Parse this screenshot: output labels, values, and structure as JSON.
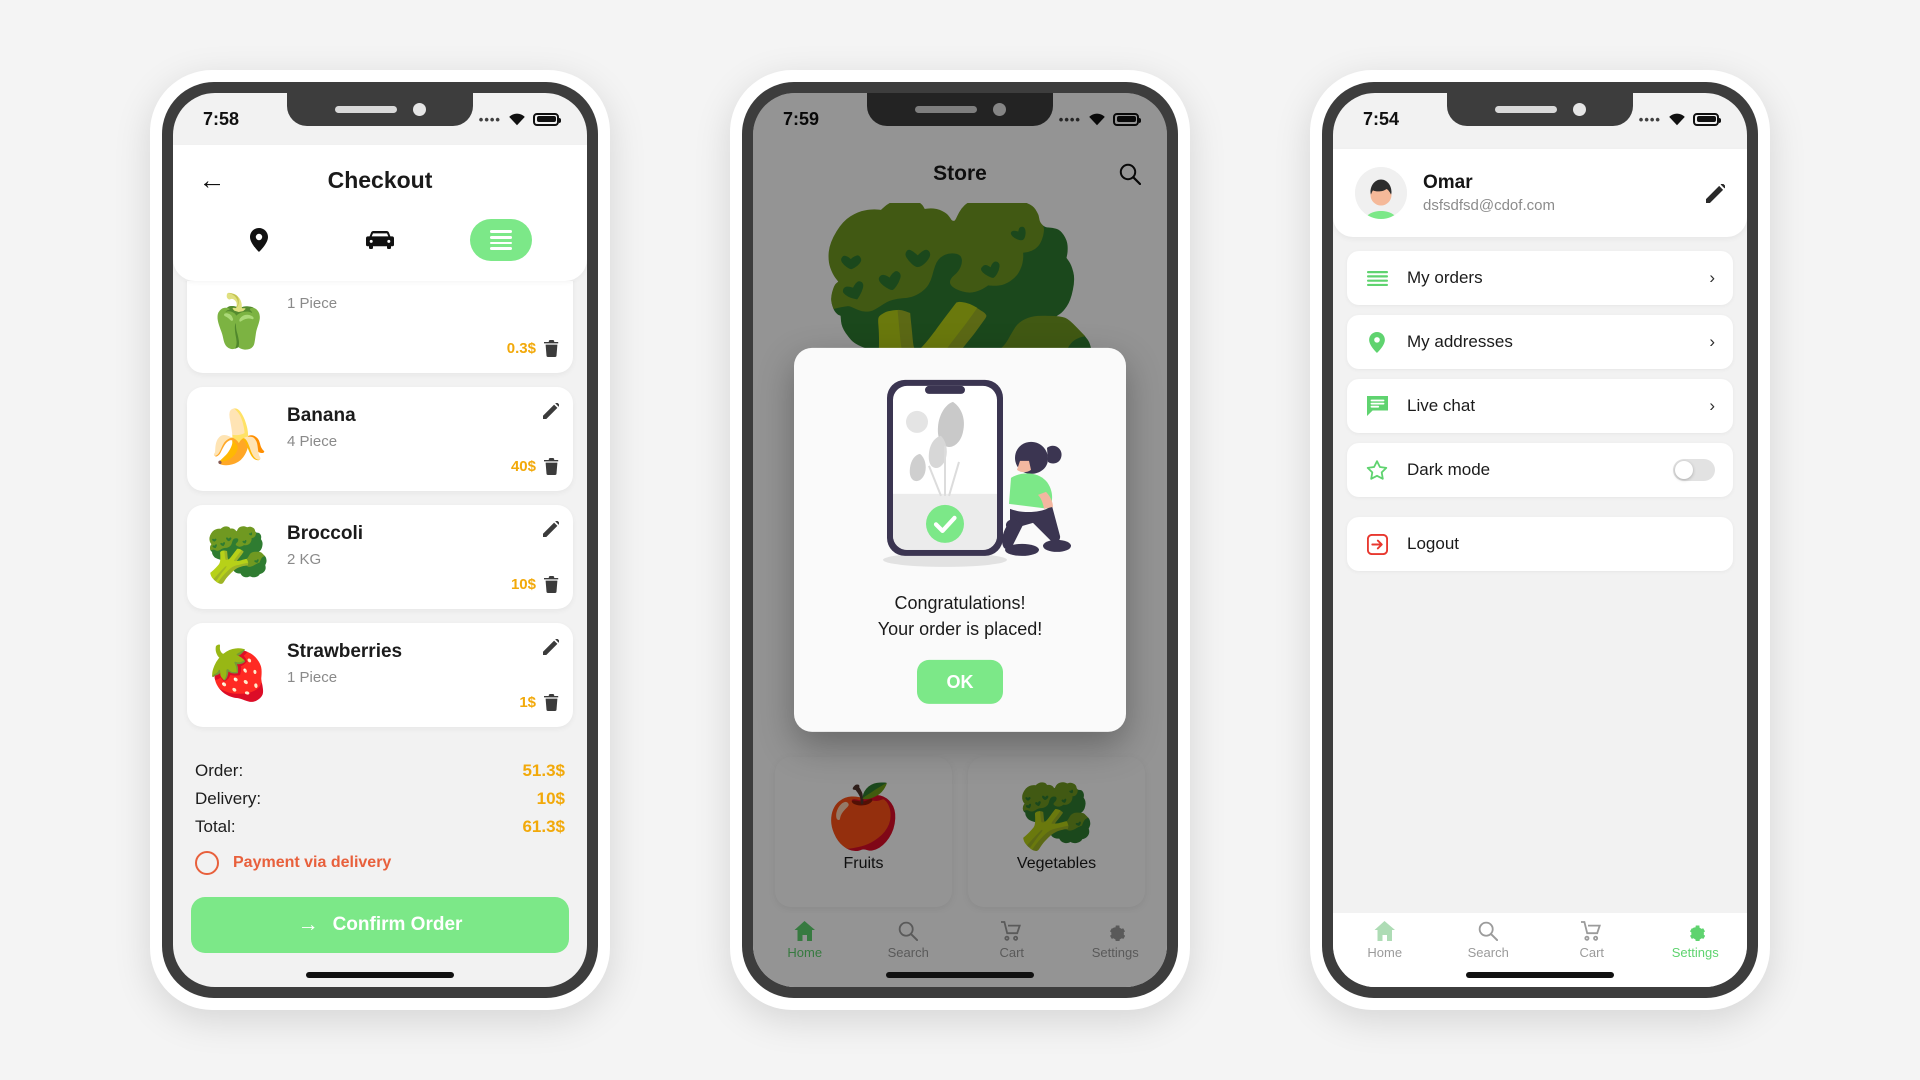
{
  "accent": "#7ce888",
  "price_color": "#f2a90a",
  "payment_color": "#e8603c",
  "phone1": {
    "status": {
      "time": "7:58",
      "signal_icon": "signal-dots-icon",
      "wifi_icon": "wifi-icon",
      "battery_icon": "battery-icon"
    },
    "header": {
      "back_icon": "back-arrow-icon",
      "title": "Checkout"
    },
    "steps": [
      {
        "name": "location-step",
        "icon": "location-pin-icon",
        "active": false
      },
      {
        "name": "delivery-step",
        "icon": "car-icon",
        "active": false
      },
      {
        "name": "summary-step",
        "icon": "list-lines-icon",
        "active": true
      }
    ],
    "items": [
      {
        "emoji": "🫑",
        "name": "",
        "qty": "1 Piece",
        "price": "0.3$",
        "edit_icon": "pencil-icon",
        "delete_icon": "trash-icon",
        "clipped": true
      },
      {
        "emoji": "🍌",
        "name": "Banana",
        "qty": "4 Piece",
        "price": "40$",
        "edit_icon": "pencil-icon",
        "delete_icon": "trash-icon",
        "clipped": false
      },
      {
        "emoji": "🥦",
        "name": "Broccoli",
        "qty": "2 KG",
        "price": "10$",
        "edit_icon": "pencil-icon",
        "delete_icon": "trash-icon",
        "clipped": false
      },
      {
        "emoji": "🍓",
        "name": "Strawberries",
        "qty": "1 Piece",
        "price": "1$",
        "edit_icon": "pencil-icon",
        "delete_icon": "trash-icon",
        "clipped": false
      }
    ],
    "summary": [
      {
        "label": "Order:",
        "value": "51.3$"
      },
      {
        "label": "Delivery:",
        "value": "10$"
      },
      {
        "label": "Total:",
        "value": "61.3$"
      }
    ],
    "payment": {
      "radio_icon": "radio-unchecked-icon",
      "label": "Payment via delivery"
    },
    "confirm": {
      "arrow_icon": "arrow-right-icon",
      "label": "Confirm Order"
    }
  },
  "phone2": {
    "status": {
      "time": "7:59",
      "signal_icon": "signal-dots-icon",
      "wifi_icon": "wifi-icon",
      "battery_icon": "battery-icon"
    },
    "header": {
      "title": "Store",
      "search_icon": "search-icon"
    },
    "hero_emoji": "🥦",
    "categories": [
      {
        "emoji": "🍎",
        "label": "Fruits"
      },
      {
        "emoji": "🥦",
        "label": "Vegetables"
      }
    ],
    "dialog": {
      "illustration": "order-placed-illustration",
      "line1": "Congratulations!",
      "line2": "Your order is placed!",
      "ok_label": "OK"
    },
    "nav": [
      {
        "label": "Home",
        "icon": "home-icon",
        "active": true
      },
      {
        "label": "Search",
        "icon": "search-icon",
        "active": false
      },
      {
        "label": "Cart",
        "icon": "cart-icon",
        "active": false
      },
      {
        "label": "Settings",
        "icon": "gear-icon",
        "active": false
      }
    ]
  },
  "phone3": {
    "status": {
      "time": "7:54",
      "signal_icon": "signal-dots-icon",
      "wifi_icon": "wifi-icon",
      "battery_icon": "battery-icon"
    },
    "profile": {
      "avatar": "user-avatar",
      "name": "Omar",
      "email": "dsfsdfsd@cdof.com",
      "edit_icon": "pencil-icon"
    },
    "menu": [
      {
        "label": "My orders",
        "icon": "list-lines-icon",
        "trailing": "chevron-right-icon"
      },
      {
        "label": "My addresses",
        "icon": "location-pin-icon",
        "trailing": "chevron-right-icon"
      },
      {
        "label": "Live chat",
        "icon": "chat-bubble-icon",
        "trailing": "chevron-right-icon"
      },
      {
        "label": "Dark mode",
        "icon": "star-icon",
        "trailing": "toggle-off"
      },
      {
        "label": "Logout",
        "icon": "logout-icon",
        "trailing": "none"
      }
    ],
    "nav": [
      {
        "label": "Home",
        "icon": "home-icon",
        "active": false
      },
      {
        "label": "Search",
        "icon": "search-icon",
        "active": false
      },
      {
        "label": "Cart",
        "icon": "cart-icon",
        "active": false
      },
      {
        "label": "Settings",
        "icon": "gear-icon",
        "active": true
      }
    ]
  }
}
